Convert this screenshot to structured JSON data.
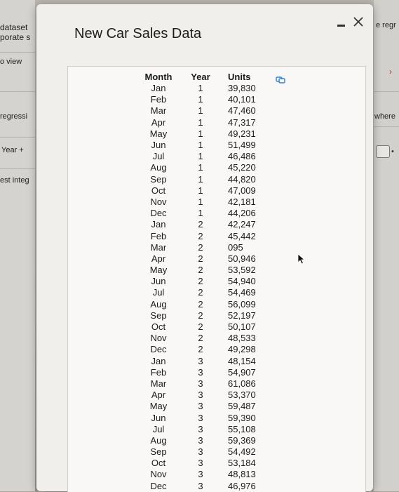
{
  "background": {
    "left_fragments": [
      "dataset",
      "porate s",
      "o view",
      "regressi",
      "Year +",
      "est integ"
    ],
    "right_fragments": [
      "e regr",
      "where"
    ]
  },
  "dialog": {
    "title": "New Car Sales Data",
    "minimize_label": "minimize-icon",
    "close_label": "close-icon"
  },
  "table": {
    "headers": [
      "Month",
      "Year",
      "Units"
    ],
    "rows": [
      [
        "Jan",
        "1",
        "39,830"
      ],
      [
        "Feb",
        "1",
        "40,101"
      ],
      [
        "Mar",
        "1",
        "47,460"
      ],
      [
        "Apr",
        "1",
        "47,317"
      ],
      [
        "May",
        "1",
        "49,231"
      ],
      [
        "Jun",
        "1",
        "51,499"
      ],
      [
        "Jul",
        "1",
        "46,486"
      ],
      [
        "Aug",
        "1",
        "45,220"
      ],
      [
        "Sep",
        "1",
        "44,820"
      ],
      [
        "Oct",
        "1",
        "47,009"
      ],
      [
        "Nov",
        "1",
        "42,181"
      ],
      [
        "Dec",
        "1",
        "44,206"
      ],
      [
        "Jan",
        "2",
        "42,247"
      ],
      [
        "Feb",
        "2",
        "45,442"
      ],
      [
        "Mar",
        "2",
        "095"
      ],
      [
        "Apr",
        "2",
        "50,946"
      ],
      [
        "May",
        "2",
        "53,592"
      ],
      [
        "Jun",
        "2",
        "54,940"
      ],
      [
        "Jul",
        "2",
        "54,469"
      ],
      [
        "Aug",
        "2",
        "56,099"
      ],
      [
        "Sep",
        "2",
        "52,197"
      ],
      [
        "Oct",
        "2",
        "50,107"
      ],
      [
        "Nov",
        "2",
        "48,533"
      ],
      [
        "Dec",
        "2",
        "49,298"
      ],
      [
        "Jan",
        "3",
        "48,154"
      ],
      [
        "Feb",
        "3",
        "54,907"
      ],
      [
        "Mar",
        "3",
        "61,086"
      ],
      [
        "Apr",
        "3",
        "53,370"
      ],
      [
        "May",
        "3",
        "59,487"
      ],
      [
        "Jun",
        "3",
        "59,390"
      ],
      [
        "Jul",
        "3",
        "55,108"
      ],
      [
        "Aug",
        "3",
        "59,369"
      ],
      [
        "Sep",
        "3",
        "54,492"
      ],
      [
        "Oct",
        "3",
        "53,184"
      ],
      [
        "Nov",
        "3",
        "48,813"
      ],
      [
        "Dec",
        "3",
        "46,976"
      ]
    ]
  },
  "icons": {
    "copy": "copy-icon",
    "cursor": "mouse-cursor-icon"
  },
  "colors": {
    "dialog_bg": "#f1efec",
    "panel_bg": "#f9f8f6",
    "copy_icon": "#2f7fd8"
  }
}
